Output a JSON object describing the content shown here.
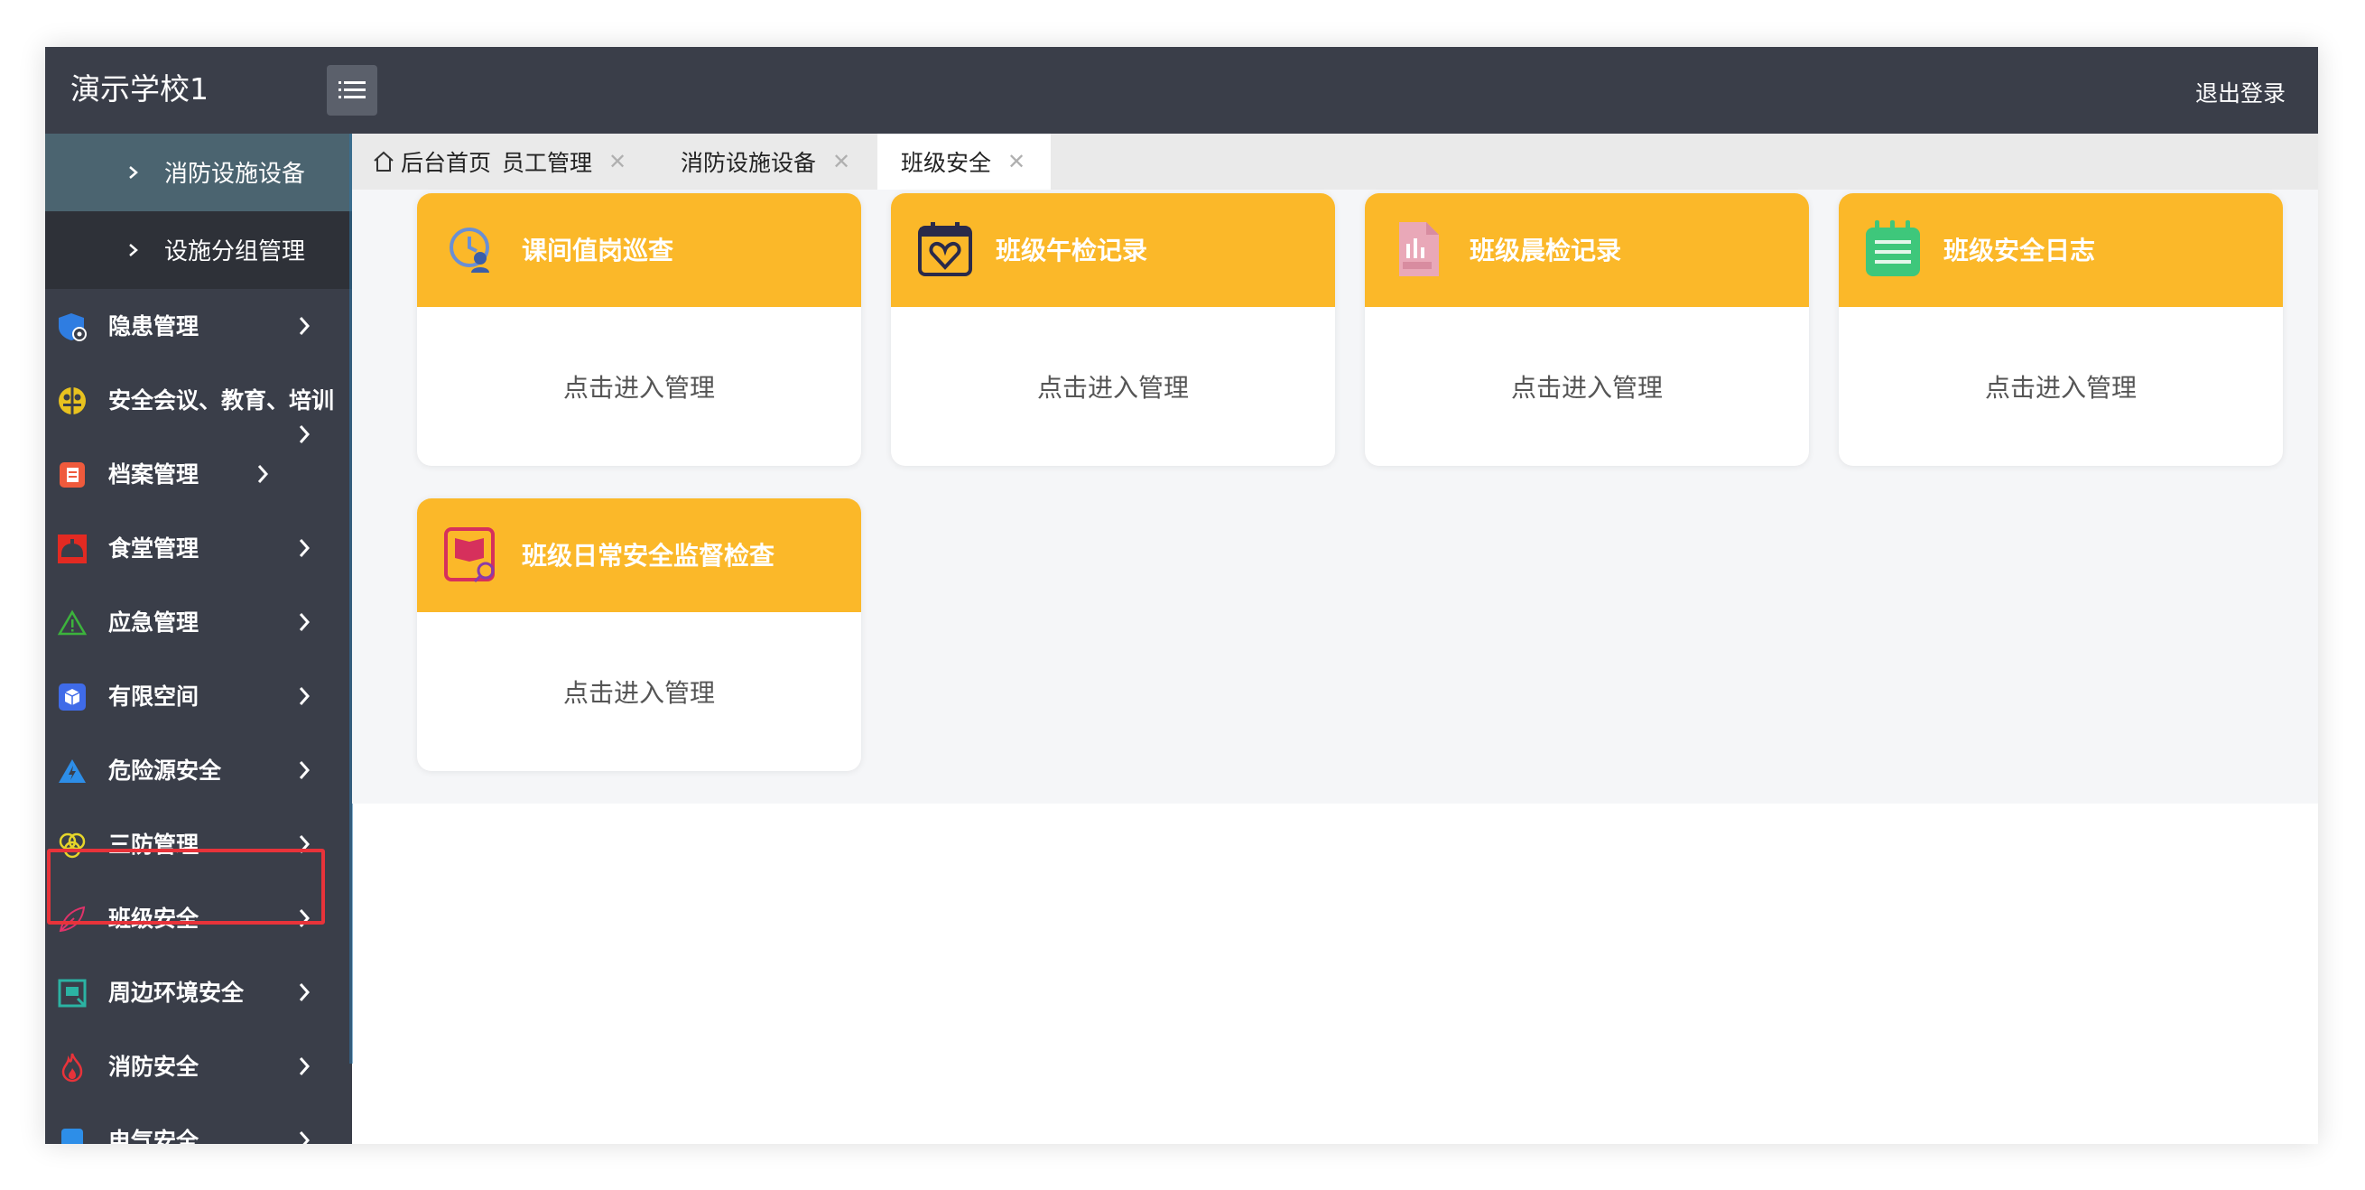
{
  "app": {
    "title": "演示学校1",
    "logout": "退出登录"
  },
  "colors": {
    "header_bg": "#3a3e49",
    "card_header": "#fbb829",
    "highlight": "#e8333a"
  },
  "sidebar": {
    "sub_items": [
      {
        "label": "消防设施设备",
        "active": true
      },
      {
        "label": "设施分组管理",
        "active": false
      }
    ],
    "items": [
      {
        "label": "隐患管理",
        "icon": "shield-gear-icon"
      },
      {
        "label": "安全会议、教育、培训",
        "icon": "meeting-icon"
      },
      {
        "label": "档案管理",
        "icon": "archive-icon"
      },
      {
        "label": "食堂管理",
        "icon": "canteen-bell-icon"
      },
      {
        "label": "应急管理",
        "icon": "warning-triangle-icon"
      },
      {
        "label": "有限空间",
        "icon": "cube-icon"
      },
      {
        "label": "危险源安全",
        "icon": "hazard-icon"
      },
      {
        "label": "三防管理",
        "icon": "triple-defense-icon"
      },
      {
        "label": "班级安全",
        "icon": "leaf-icon",
        "highlighted": true
      },
      {
        "label": "周边环境安全",
        "icon": "environment-icon"
      },
      {
        "label": "消防安全",
        "icon": "fire-icon"
      },
      {
        "label": "电气安全",
        "icon": "electric-icon"
      }
    ]
  },
  "tabs": [
    {
      "label": "后台首页",
      "icon": "home-icon",
      "closable": false
    },
    {
      "label": "员工管理",
      "closable": true
    },
    {
      "label": "消防设施设备",
      "closable": true
    },
    {
      "label": "班级安全",
      "closable": true,
      "active": true
    }
  ],
  "cards": [
    {
      "title": "课间值岗巡查",
      "action": "点击进入管理",
      "icon": "patrol-clock-icon"
    },
    {
      "title": "班级午检记录",
      "action": "点击进入管理",
      "icon": "calendar-heart-icon"
    },
    {
      "title": "班级晨检记录",
      "action": "点击进入管理",
      "icon": "report-file-icon"
    },
    {
      "title": "班级安全日志",
      "action": "点击进入管理",
      "icon": "notepad-icon"
    },
    {
      "title": "班级日常安全监督检查",
      "action": "点击进入管理",
      "icon": "book-inspect-icon"
    }
  ]
}
